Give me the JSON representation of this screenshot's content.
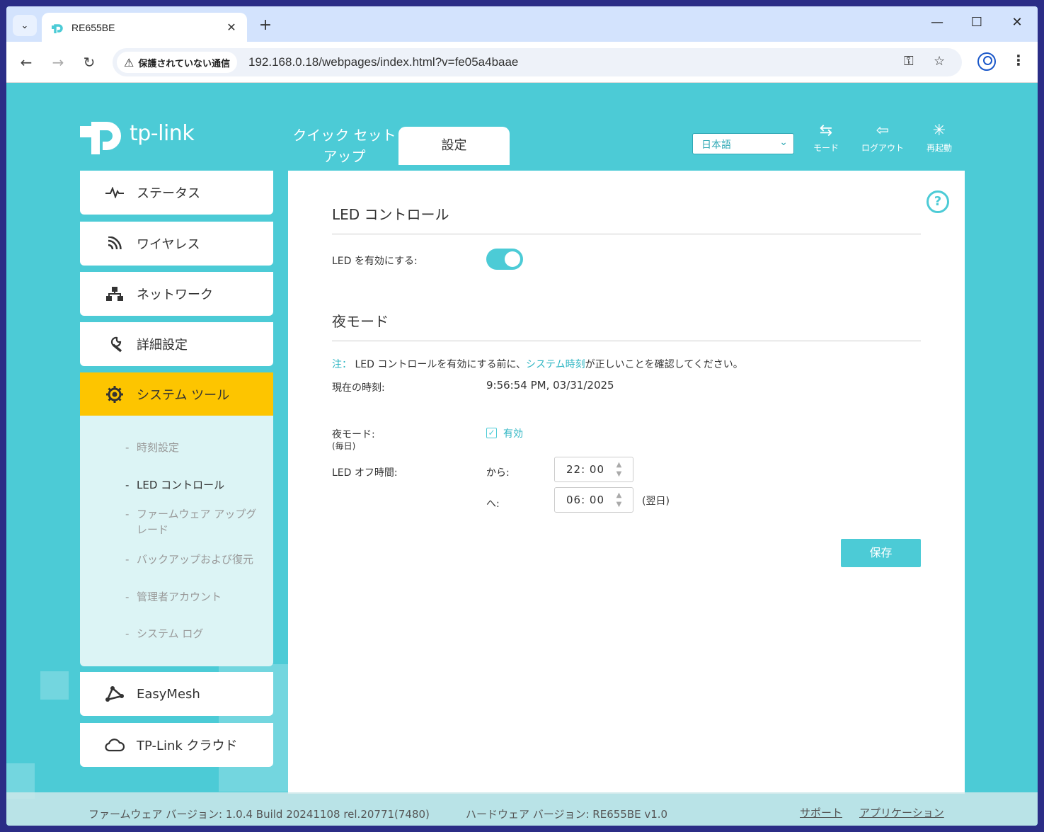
{
  "browser": {
    "tab_title": "RE655BE",
    "security_label": "保護されていない通信",
    "url": "192.168.0.18/webpages/index.html?v=fe05a4baae"
  },
  "header": {
    "logo_text": "tp-link",
    "quick_setup_tab": "クイック セットアップ",
    "settings_tab": "設定",
    "language": "日本語",
    "mode_label": "モード",
    "logout_label": "ログアウト",
    "reboot_label": "再起動"
  },
  "sidebar": {
    "items": [
      {
        "label": "ステータス",
        "icon": "pulse-icon"
      },
      {
        "label": "ワイヤレス",
        "icon": "wireless-icon"
      },
      {
        "label": "ネットワーク",
        "icon": "network-icon"
      },
      {
        "label": "詳細設定",
        "icon": "wrench-icon"
      },
      {
        "label": "システム ツール",
        "icon": "gear-icon"
      },
      {
        "label": "EasyMesh",
        "icon": "mesh-icon"
      },
      {
        "label": "TP-Link クラウド",
        "icon": "cloud-icon"
      }
    ],
    "submenu": [
      {
        "label": "時刻設定"
      },
      {
        "label": "LED コントロール"
      },
      {
        "label": "ファームウェア アップグレード"
      },
      {
        "label": "バックアップおよび復元"
      },
      {
        "label": "管理者アカウント"
      },
      {
        "label": "システム ログ"
      }
    ]
  },
  "content": {
    "led_section_title": "LED コントロール",
    "led_enable_label": "LED を有効にする:",
    "led_enabled": true,
    "night_section_title": "夜モード",
    "note_prefix": "注：",
    "note_before": " LED コントロールを有効にする前に、",
    "note_link": "システム時刻",
    "note_after": "が正しいことを確認してください。",
    "current_time_label": "現在の時刻:",
    "current_time_value": "9:56:54 PM, 03/31/2025",
    "night_mode_label": "夜モード:",
    "night_mode_sub": "(毎日)",
    "night_mode_check_label": "有効",
    "led_off_label": "LED オフ時間:",
    "from_label": "から:",
    "from_value": "22: 00",
    "to_label": "へ:",
    "to_value": "06: 00",
    "next_day": "(翌日)",
    "save_label": "保存"
  },
  "footer": {
    "firmware": "ファームウェア バージョン: 1.0.4 Build 20241108 rel.20771(7480)",
    "hardware": "ハードウェア バージョン: RE655BE v1.0",
    "support": "サポート",
    "app": "アプリケーション"
  }
}
